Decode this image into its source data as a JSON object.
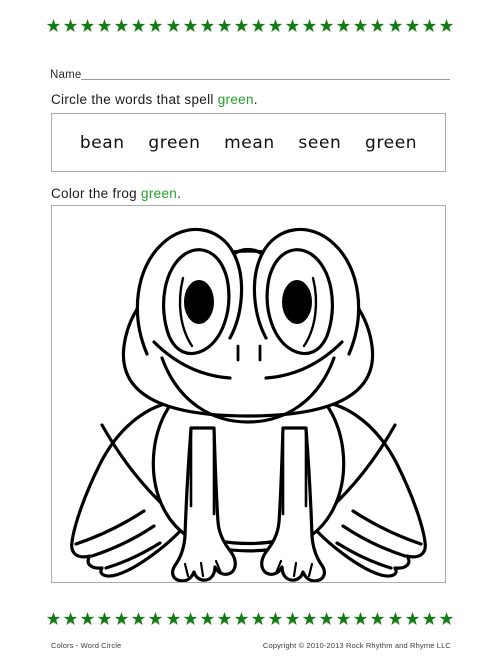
{
  "worksheet": {
    "title": "Colors - Word Circle",
    "accent_green": "#22a22a",
    "star_green": "#157c15",
    "border_color": "#aaaaaa"
  },
  "decoration": {
    "top_border": {
      "icon": "star-icon",
      "count": 24,
      "color": "#157c15"
    },
    "bottom_border": {
      "icon": "star-icon",
      "count": 24,
      "color": "#157c15"
    }
  },
  "name_field": {
    "label": "Name",
    "value": "",
    "placeholder": ""
  },
  "activities": [
    {
      "instruction_prefix": "Circle the words that spell ",
      "instruction_keyword": "green",
      "instruction_suffix": ".",
      "words": [
        "bean",
        "green",
        "mean",
        "seen",
        "green"
      ]
    },
    {
      "instruction_prefix": "Color the frog ",
      "instruction_keyword": "green",
      "instruction_suffix": ".",
      "image": "frog-line-art"
    }
  ],
  "words": {
    "w0": "bean",
    "w1": "green",
    "w2": "mean",
    "w3": "seen",
    "w4": "green"
  },
  "instructions": {
    "circle_prefix": "Circle the words that spell ",
    "circle_keyword": "green",
    "circle_suffix": ".",
    "color_prefix": "Color the frog ",
    "color_keyword": "green",
    "color_suffix": "."
  },
  "footer": {
    "left": "Colors - Word Circle",
    "right": "Copyright © 2010-2013 Rock Rhythm and Rhyme LLC"
  }
}
